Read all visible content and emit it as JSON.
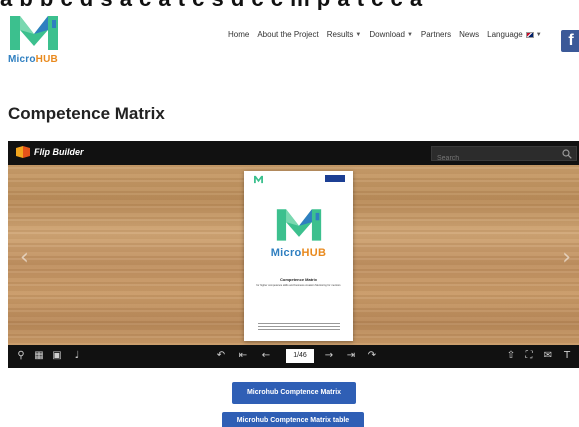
{
  "top_cut_text": "a b b c d   s   a c a t c   s d   c c m p a t c   c a",
  "brand": {
    "logo_part1": "Micro",
    "logo_part2": "HUB"
  },
  "nav": {
    "items": [
      {
        "label": "Home",
        "dropdown": false
      },
      {
        "label": "About the Project",
        "dropdown": false
      },
      {
        "label": "Results",
        "dropdown": true
      },
      {
        "label": "Download",
        "dropdown": true
      },
      {
        "label": "Partners",
        "dropdown": false
      },
      {
        "label": "News",
        "dropdown": false
      }
    ],
    "language_label": "Language",
    "facebook_glyph": "f"
  },
  "page_title": "Competence Matrix",
  "flipbook": {
    "brand_label": "Flip Builder",
    "search_placeholder": "Search",
    "page_indicator": "1/46",
    "doc": {
      "logo_part1": "Micro",
      "logo_part2": "HUB",
      "title": "Competence Matrix",
      "subtitle": "for higher competence skills and business creation Mentoring for mentors"
    }
  },
  "buttons": {
    "matrix": "Microhub Comptence Matrix",
    "matrix_table": "Microhub Comptence Matrix table"
  },
  "colors": {
    "accent_blue": "#2f5fb5",
    "logo_blue": "#2f7fc0",
    "logo_orange": "#e98a1e",
    "logo_green": "#3cc08e",
    "facebook_blue": "#3b5998"
  }
}
